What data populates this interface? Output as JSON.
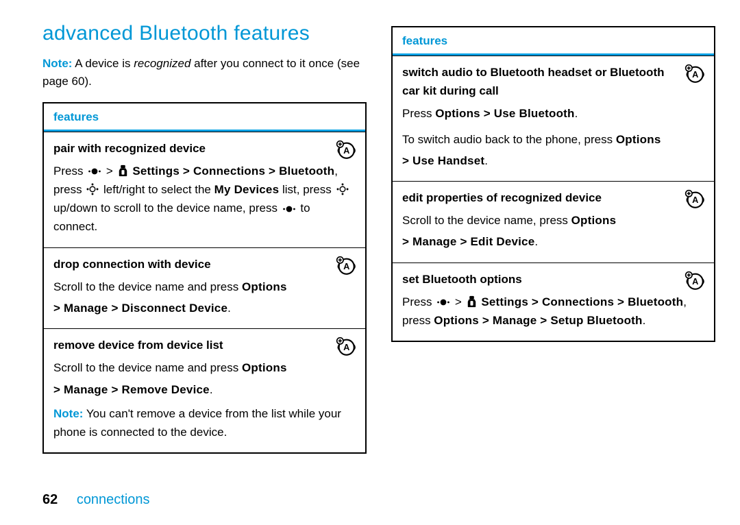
{
  "heading": "advanced Bluetooth features",
  "intro": {
    "note_label": "Note:",
    "before": " A device is ",
    "recognized": "recognized",
    "after": " after you connect to it once (see page 60)."
  },
  "table_header": "features",
  "left": {
    "r1": {
      "title": "pair with recognized device",
      "l1a": "Press ",
      "l1b": " > ",
      "l1c": " Settings > Connections > Bluetooth",
      "l2a": ", press ",
      "l2b": " left/right to select the ",
      "l2c": "My Devices",
      "l2d": " list, press ",
      "l3a": " up/down to scroll to the device name, press ",
      "l3b": " to connect."
    },
    "r2": {
      "title": "drop connection with device",
      "l1": "Scroll to the device name and press ",
      "opt": "Options",
      "l2": "> Manage > Disconnect Device",
      "dot": "."
    },
    "r3": {
      "title": "remove device from device list",
      "l1": "Scroll to the device name and press ",
      "opt": "Options",
      "l2": "> Manage > Remove Device",
      "dot": ".",
      "note_label": "Note:",
      "note": " You can't remove a device from the list while your phone is connected to the device."
    }
  },
  "right": {
    "r1": {
      "title": "switch audio to Bluetooth headset or Bluetooth car kit during call",
      "l1a": "Press ",
      "l1b": "Options > Use Bluetooth",
      "dot1": ".",
      "l2a": "To switch audio back to the phone, press ",
      "l2b": "Options",
      "l3": "> Use Handset",
      "dot2": "."
    },
    "r2": {
      "title": "edit properties of recognized device",
      "l1": "Scroll to the device name, press ",
      "opt": "Options",
      "l2": "> Manage > Edit Device",
      "dot": "."
    },
    "r3": {
      "title": "set Bluetooth options",
      "l1a": "Press ",
      "l1b": " > ",
      "l1c": " Settings > Connections > Bluetooth",
      "l2a": ", press ",
      "l2b": "Options > Manage > Setup Bluetooth",
      "dot": "."
    }
  },
  "footer": {
    "page": "62",
    "section": "connections"
  }
}
